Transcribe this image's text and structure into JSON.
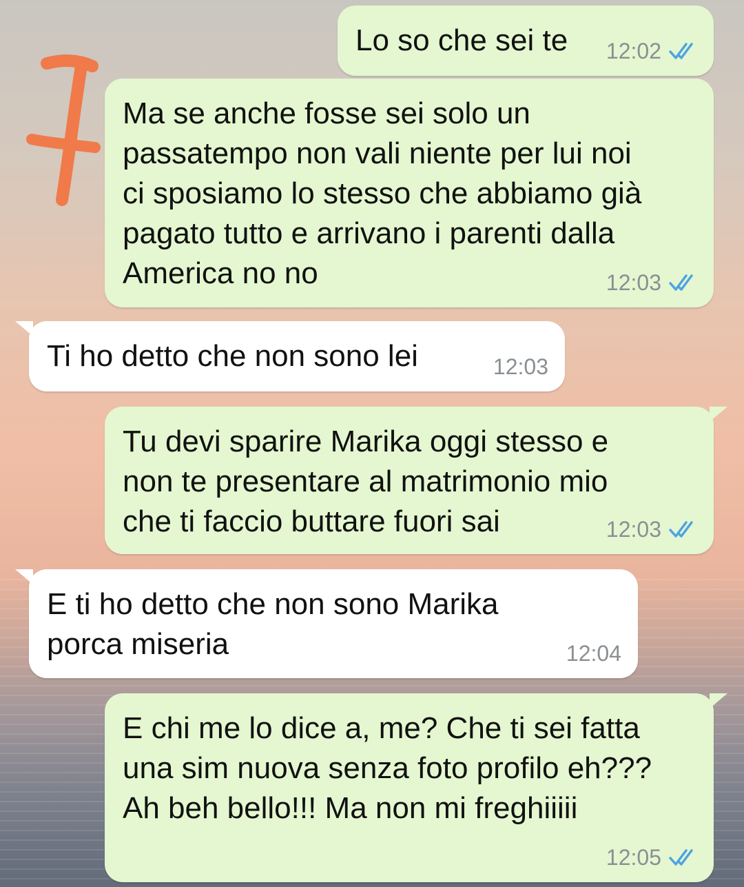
{
  "colors": {
    "outgoing_bubble": "#e4f7d0",
    "incoming_bubble": "#ffffff",
    "tick_blue": "#4fa3e3",
    "timestamp_gray": "#8a8f93",
    "annotation_orange": "#f07a4a"
  },
  "icons": {
    "read_receipt": "double-check-icon",
    "annotation": "handwritten-mark"
  },
  "messages": [
    {
      "direction": "outgoing",
      "text": "Lo so che sei te",
      "time": "12:02",
      "status": "read"
    },
    {
      "direction": "outgoing",
      "text": "Ma se anche fosse sei solo un\npassatempo non vali niente per lui noi\nci sposiamo lo stesso che abbiamo già\npagato tutto e arrivano i parenti dalla\nAmerica no no",
      "time": "12:03",
      "status": "read"
    },
    {
      "direction": "incoming",
      "text": "Ti ho detto che non sono lei",
      "time": "12:03"
    },
    {
      "direction": "outgoing",
      "text": "Tu devi sparire Marika oggi stesso e\nnon te presentare al matrimonio mio\nche ti faccio buttare fuori sai",
      "time": "12:03",
      "status": "read"
    },
    {
      "direction": "incoming",
      "text": "E ti ho detto che non sono Marika\nporca miseria",
      "time": "12:04"
    },
    {
      "direction": "outgoing",
      "text": "E chi me lo dice a, me? Che ti sei fatta\nuna sim nuova senza foto profilo eh???\nAh beh bello!!! Ma non mi freghiiiii",
      "time": "12:05",
      "status": "read"
    }
  ]
}
